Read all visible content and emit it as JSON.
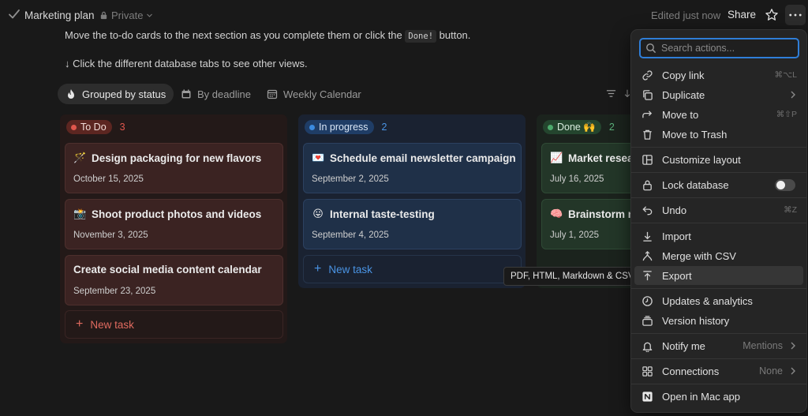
{
  "topbar": {
    "title": "Marketing plan",
    "privacy": "Private",
    "edited": "Edited just now",
    "share": "Share"
  },
  "description": {
    "line1_before": "Move the to-do cards to the next section as you complete them or click the",
    "line1_code": "Done!",
    "line1_after": "button.",
    "line2": "↓ Click the different database tabs to see other views."
  },
  "tabs": [
    {
      "label": "Grouped by status",
      "icon": "fire-icon",
      "active": true
    },
    {
      "label": "By deadline",
      "icon": "calendar-folder-icon",
      "active": false
    },
    {
      "label": "Weekly Calendar",
      "icon": "calendar-icon",
      "active": false
    }
  ],
  "board": {
    "todo": {
      "label": "To Do",
      "count": "3",
      "color": "#e0574d",
      "cards": [
        {
          "emoji": "🪄",
          "title": "Design packaging for new flavors",
          "date": "October 15, 2025"
        },
        {
          "emoji": "📸",
          "title": "Shoot product photos and videos",
          "date": "November 3, 2025"
        },
        {
          "emoji": "",
          "title": "Create social media content calendar",
          "date": "September 23, 2025"
        }
      ],
      "new_task": "New task"
    },
    "progress": {
      "label": "In progress",
      "count": "2",
      "color": "#3b8be0",
      "cards": [
        {
          "emoji": "💌",
          "title": "Schedule email newsletter campaign",
          "date": "September 2, 2025"
        },
        {
          "emoji": "😛",
          "title": "Internal taste-testing",
          "date": "September 4, 2025"
        }
      ],
      "new_task": "New task"
    },
    "done": {
      "label": "Done 🙌",
      "count": "2",
      "color": "#4caa6c",
      "cards": [
        {
          "emoji": "📈",
          "title": "Market researc",
          "date": "July 16, 2025"
        },
        {
          "emoji": "🧠",
          "title": "Brainstorm ne",
          "date": "July 1, 2025"
        }
      ]
    }
  },
  "tooltip": "PDF, HTML, Markdown & CSV",
  "menu": {
    "search_placeholder": "Search actions...",
    "items": {
      "copy_link": {
        "label": "Copy link",
        "shortcut": "⌘⌥L"
      },
      "duplicate": {
        "label": "Duplicate"
      },
      "move_to": {
        "label": "Move to",
        "shortcut": "⌘⇧P"
      },
      "trash": {
        "label": "Move to Trash"
      },
      "customize": {
        "label": "Customize layout"
      },
      "lock": {
        "label": "Lock database",
        "enabled": false
      },
      "undo": {
        "label": "Undo",
        "shortcut": "⌘Z"
      },
      "import": {
        "label": "Import"
      },
      "merge": {
        "label": "Merge with CSV"
      },
      "export": {
        "label": "Export"
      },
      "updates": {
        "label": "Updates & analytics"
      },
      "version": {
        "label": "Version history"
      },
      "notify": {
        "label": "Notify me",
        "value": "Mentions"
      },
      "connections": {
        "label": "Connections",
        "value": "None"
      },
      "open_mac": {
        "label": "Open in Mac app"
      }
    }
  },
  "colors": {
    "accent": "#2f7ed8",
    "background": "#191919"
  }
}
